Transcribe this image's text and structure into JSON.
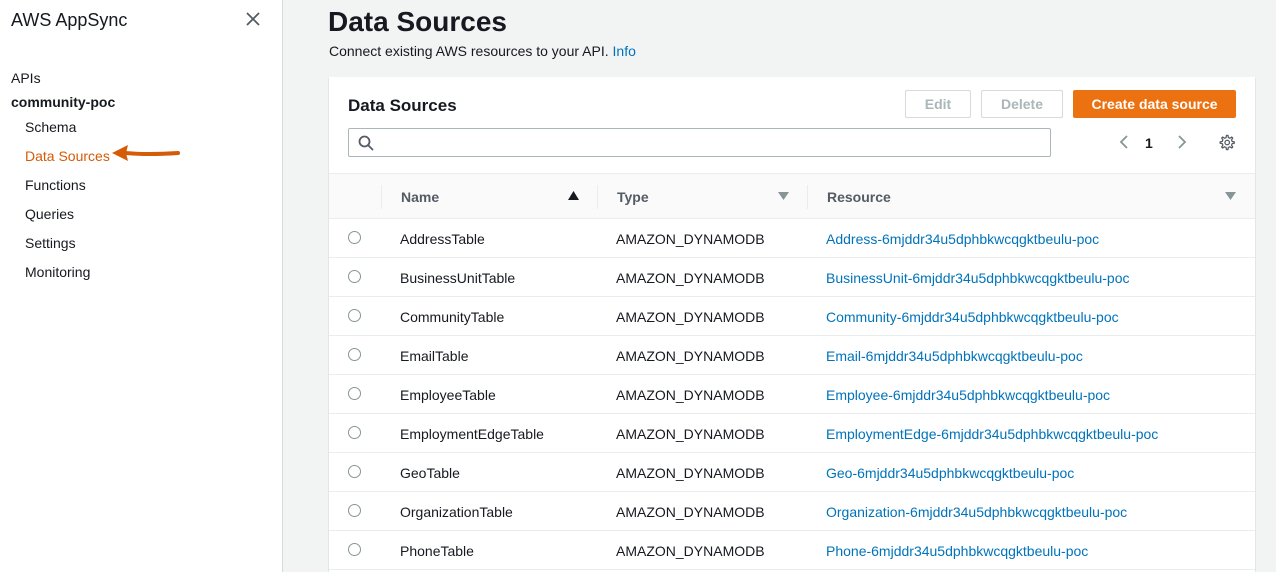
{
  "sidebar": {
    "title": "AWS AppSync",
    "apis_label": "APIs",
    "api_name": "community-poc",
    "items": [
      {
        "label": "Schema",
        "active": false
      },
      {
        "label": "Data Sources",
        "active": true
      },
      {
        "label": "Functions",
        "active": false
      },
      {
        "label": "Queries",
        "active": false
      },
      {
        "label": "Settings",
        "active": false
      },
      {
        "label": "Monitoring",
        "active": false
      }
    ]
  },
  "page": {
    "title": "Data Sources",
    "subtitle": "Connect existing AWS resources to your API.",
    "info_link": "Info"
  },
  "panel": {
    "title": "Data Sources",
    "edit_label": "Edit",
    "delete_label": "Delete",
    "create_label": "Create data source",
    "search_value": "",
    "page_number": "1"
  },
  "table": {
    "columns": [
      "Name",
      "Type",
      "Resource"
    ],
    "rows": [
      {
        "name": "AddressTable",
        "type": "AMAZON_DYNAMODB",
        "resource": "Address-6mjddr34u5dphbkwcqgktbeulu-poc"
      },
      {
        "name": "BusinessUnitTable",
        "type": "AMAZON_DYNAMODB",
        "resource": "BusinessUnit-6mjddr34u5dphbkwcqgktbeulu-poc"
      },
      {
        "name": "CommunityTable",
        "type": "AMAZON_DYNAMODB",
        "resource": "Community-6mjddr34u5dphbkwcqgktbeulu-poc"
      },
      {
        "name": "EmailTable",
        "type": "AMAZON_DYNAMODB",
        "resource": "Email-6mjddr34u5dphbkwcqgktbeulu-poc"
      },
      {
        "name": "EmployeeTable",
        "type": "AMAZON_DYNAMODB",
        "resource": "Employee-6mjddr34u5dphbkwcqgktbeulu-poc"
      },
      {
        "name": "EmploymentEdgeTable",
        "type": "AMAZON_DYNAMODB",
        "resource": "EmploymentEdge-6mjddr34u5dphbkwcqgktbeulu-poc"
      },
      {
        "name": "GeoTable",
        "type": "AMAZON_DYNAMODB",
        "resource": "Geo-6mjddr34u5dphbkwcqgktbeulu-poc"
      },
      {
        "name": "OrganizationTable",
        "type": "AMAZON_DYNAMODB",
        "resource": "Organization-6mjddr34u5dphbkwcqgktbeulu-poc"
      },
      {
        "name": "PhoneTable",
        "type": "AMAZON_DYNAMODB",
        "resource": "Phone-6mjddr34u5dphbkwcqgktbeulu-poc"
      }
    ]
  },
  "colors": {
    "accent": "#ec7211",
    "active_nav": "#d45b07",
    "link": "#0073bb"
  },
  "icons": [
    "close-icon",
    "annotation-arrow",
    "search-icon",
    "chevron-left-icon",
    "chevron-right-icon",
    "gear-icon",
    "sort-ascending-icon",
    "sort-descending-icon"
  ]
}
